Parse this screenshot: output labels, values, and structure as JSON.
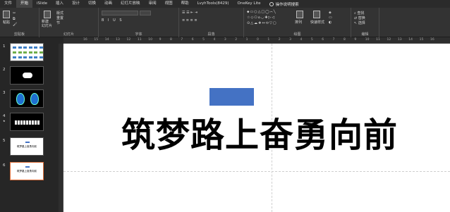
{
  "menu": {
    "items": [
      "文件",
      "开始",
      "iSlide",
      "插入",
      "设计",
      "切换",
      "动画",
      "幻灯片放映",
      "审阅",
      "视图",
      "帮助",
      "LvyhTools(8429)",
      "OneKey Lite"
    ],
    "active_index": 1,
    "tell_me": "操作说明搜索"
  },
  "ribbon": {
    "paste_label": "粘贴",
    "clipboard_label": "剪贴板",
    "new_slide_label": "新建\n幻灯片",
    "layout_label": "版式",
    "reset_label": "重置",
    "section_label": "节",
    "slides_label": "幻灯片",
    "font_label": "字体",
    "paragraph_label": "段落",
    "drawing_label": "绘图",
    "arrange_label": "排列",
    "quick_styles_label": "快速样式",
    "find_label": "查找",
    "replace_label": "替换",
    "select_label": "选择",
    "editing_label": "编辑"
  },
  "ruler": {
    "ticks": [
      "16",
      "15",
      "14",
      "13",
      "12",
      "11",
      "10",
      "9",
      "8",
      "7",
      "6",
      "5",
      "4",
      "3",
      "2",
      "1",
      "0",
      "1",
      "2",
      "3",
      "4",
      "5",
      "6",
      "7",
      "8",
      "9",
      "10",
      "11",
      "12",
      "13",
      "14",
      "15",
      "16"
    ]
  },
  "slides": [
    {
      "number": "1",
      "style": "dots"
    },
    {
      "number": "2",
      "style": "cloud"
    },
    {
      "number": "3",
      "style": "aliens"
    },
    {
      "number": "4",
      "style": "text-dark",
      "star": "★"
    },
    {
      "number": "5",
      "style": "white",
      "caption": "筑梦路上奋勇向前"
    },
    {
      "number": "6",
      "style": "white",
      "caption": "筑梦路上奋勇向前",
      "selected": true
    }
  ],
  "canvas": {
    "title": "筑梦路上奋勇向前",
    "shape_color": "#4472c4"
  }
}
